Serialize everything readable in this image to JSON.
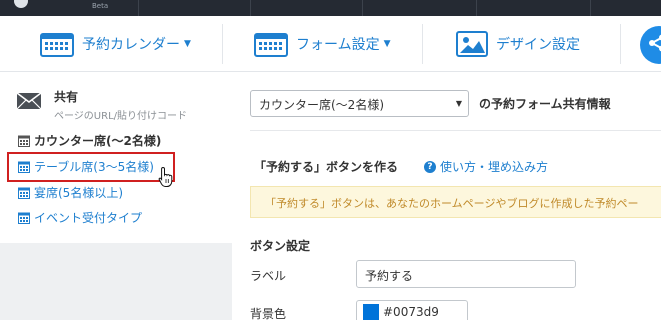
{
  "topbar": {
    "beta": "Beta"
  },
  "nav": {
    "calendar_label": "予約カレンダー",
    "form_label": "フォーム設定",
    "design_label": "デザイン設定",
    "accent": "#1e7fcf"
  },
  "sidebar": {
    "share_title": "共有",
    "share_sub": "ページのURL/貼り付けコード",
    "items": [
      {
        "label": "カウンター席(〜2名様)",
        "state": "active"
      },
      {
        "label": "テーブル席(3〜5名様)",
        "state": "highlighted"
      },
      {
        "label": "宴席(5名様以上)",
        "state": "link"
      },
      {
        "label": "イベント受付タイプ",
        "state": "link"
      }
    ]
  },
  "main": {
    "select_value": "カウンター席(〜2名様)",
    "select_suffix": "の予約フォーム共有情報",
    "section_title": "「予約する」ボタンを作る",
    "help_link": "使い方・埋め込み方",
    "notice": "「予約する」ボタンは、あなたのホームページやブログに作成した予約ペー",
    "button_settings": "ボタン設定",
    "label_field": "ラベル",
    "label_value": "予約する",
    "bg_color_field": "背景色",
    "bg_color_value": "#0073d9"
  }
}
